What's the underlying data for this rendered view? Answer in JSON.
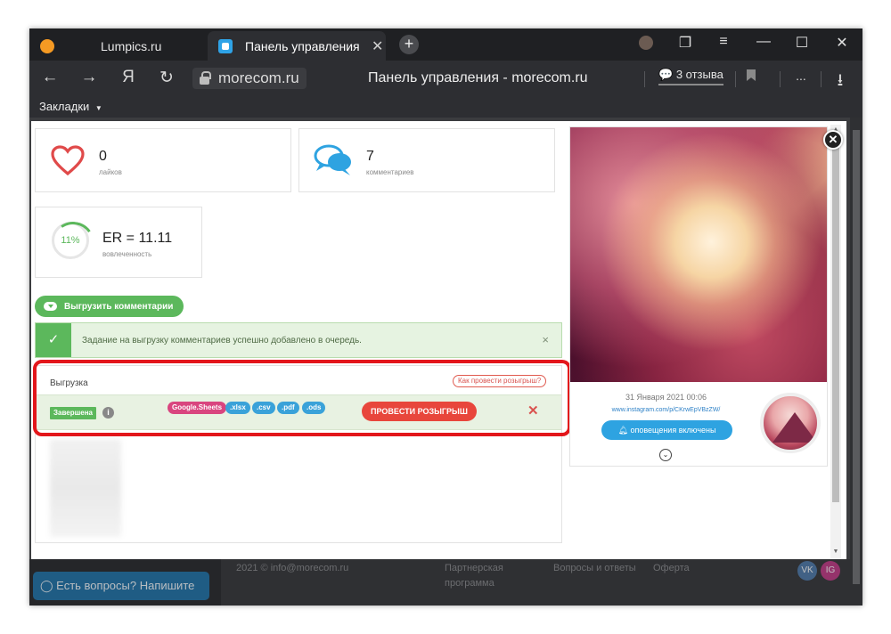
{
  "browser": {
    "tabs": [
      {
        "title": "Lumpics.ru"
      },
      {
        "title": "Панель управления - m"
      }
    ],
    "new_tab": "+",
    "url": "morecom.ru",
    "page_title": "Панель управления - morecom.ru",
    "reviews": "3 отзыва",
    "bookmarks_label": "Закладки",
    "icons": {
      "back": "←",
      "forward": "→",
      "yandex": "Я",
      "reload": "↻",
      "more": "...",
      "download": "⭳",
      "menu": "≡",
      "minimize": "—",
      "maximize": "☐",
      "close": "✕",
      "tab_close": "✕"
    }
  },
  "stats": {
    "likes": {
      "value": "0",
      "label": "лайков"
    },
    "comments": {
      "value": "7",
      "label": "комментариев"
    },
    "er": {
      "percent_text": "11%",
      "value": "ER = 11.11",
      "label": "вовлеченность",
      "percent": 11
    }
  },
  "export_button": "Выгрузить комментарии",
  "alert": {
    "text": "Задание на выгрузку комментариев успешно добавлено в очередь.",
    "close": "×",
    "check": "✓"
  },
  "export_panel": {
    "title": "Выгрузка",
    "howto": "Как провести розыгрыш?",
    "row": {
      "status": "Завершена",
      "info": "i",
      "formats": [
        "Google.Sheets",
        ".xlsx",
        ".csv",
        ".pdf",
        ".ods"
      ],
      "raffle_button": "ПРОВЕСТИ РОЗЫГРЫШ",
      "remove": "✕"
    }
  },
  "post": {
    "date": "31 Января 2021 00:06",
    "link": "www.instagram.com/p/CKrwEpVBzZW/",
    "notify_button": "оповещения включены",
    "expand": "⌄"
  },
  "modal_close": "✕",
  "footer": {
    "ask_button": "Есть вопросы? Напишите нам",
    "copyright": "2021 © info@morecom.ru",
    "links": [
      "Партнерская программа",
      "Вопросы и ответы",
      "Оферта"
    ],
    "social": [
      "VK",
      "IG"
    ]
  },
  "colors": {
    "accent_green": "#5cb85c",
    "accent_blue": "#2ea3e1",
    "accent_red": "#e8463c",
    "highlight": "#e3161b"
  }
}
